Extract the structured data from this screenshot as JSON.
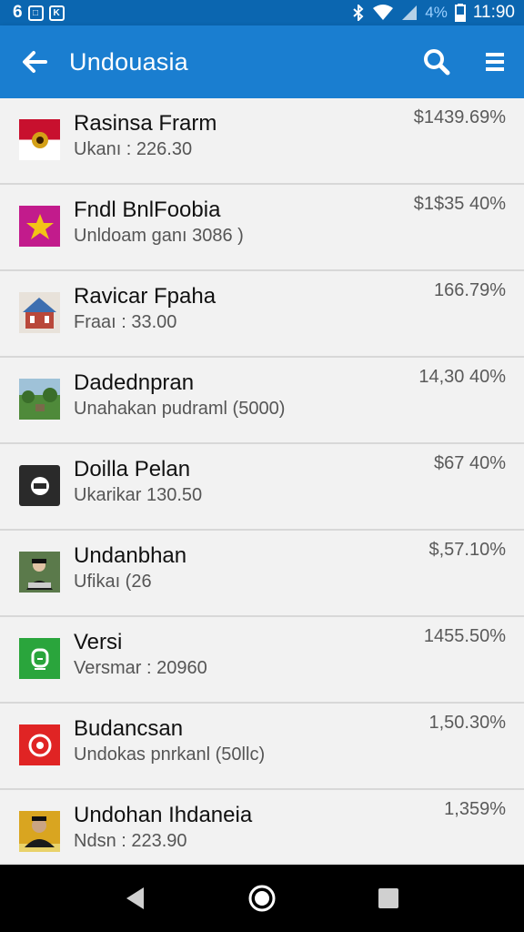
{
  "status": {
    "left_digit": "6",
    "time": "11:90",
    "battery": "4%",
    "icons": [
      "notification-box-icon",
      "notification-k-icon",
      "bluetooth-icon",
      "wifi-icon",
      "signal-icon",
      "battery-icon"
    ]
  },
  "appbar": {
    "title": "Undouasia",
    "icons": [
      "back-arrow-icon",
      "search-icon",
      "menu-icon"
    ]
  },
  "items": [
    {
      "name": "Rasinsa Frarm",
      "sub": "Ukanı : 226.30",
      "value": "$1439.69%",
      "icon": "flag-emblem-icon",
      "color": "#c8102e"
    },
    {
      "name": "Fndl BnlFoobia",
      "sub": "Unldoam ganı 3086 )",
      "value": "$1$35 40%",
      "icon": "star-badge-icon",
      "color": "#c21b8c"
    },
    {
      "name": "Ravicar Fpaha",
      "sub": "Fraaı : 33.00",
      "value": "166.79%",
      "icon": "building-icon",
      "color": "#3e6fb0"
    },
    {
      "name": "Dadednpran",
      "sub": "Unahakan pudraml (5000)",
      "value": "14,30 40%",
      "icon": "landscape-icon",
      "color": "#4f8a3a"
    },
    {
      "name": "Doilla Pelan",
      "sub": "Ukarikar 130.50",
      "value": "$67 40%",
      "icon": "dark-logo-icon",
      "color": "#2a2a2a"
    },
    {
      "name": "Undanbhan",
      "sub": "Ufikaı (26",
      "value": "$,57.10%",
      "icon": "person-photo-icon",
      "color": "#5b7a4b"
    },
    {
      "name": "Versi",
      "sub": "Versmar : 20960",
      "value": "1455.50%",
      "icon": "green-app-icon",
      "color": "#2aa53c"
    },
    {
      "name": "Budancsan",
      "sub": "Undokas pnrkanl (50llc)",
      "value": "1,50.30%",
      "icon": "red-logo-icon",
      "color": "#e02424"
    },
    {
      "name": "Undohan Ihdaneia",
      "sub": "Ndsn : 223.90",
      "value": "1,359%",
      "icon": "portrait-icon",
      "color": "#d9a520"
    }
  ],
  "nav": [
    "back-triangle-icon",
    "home-circle-icon",
    "recents-square-icon"
  ]
}
